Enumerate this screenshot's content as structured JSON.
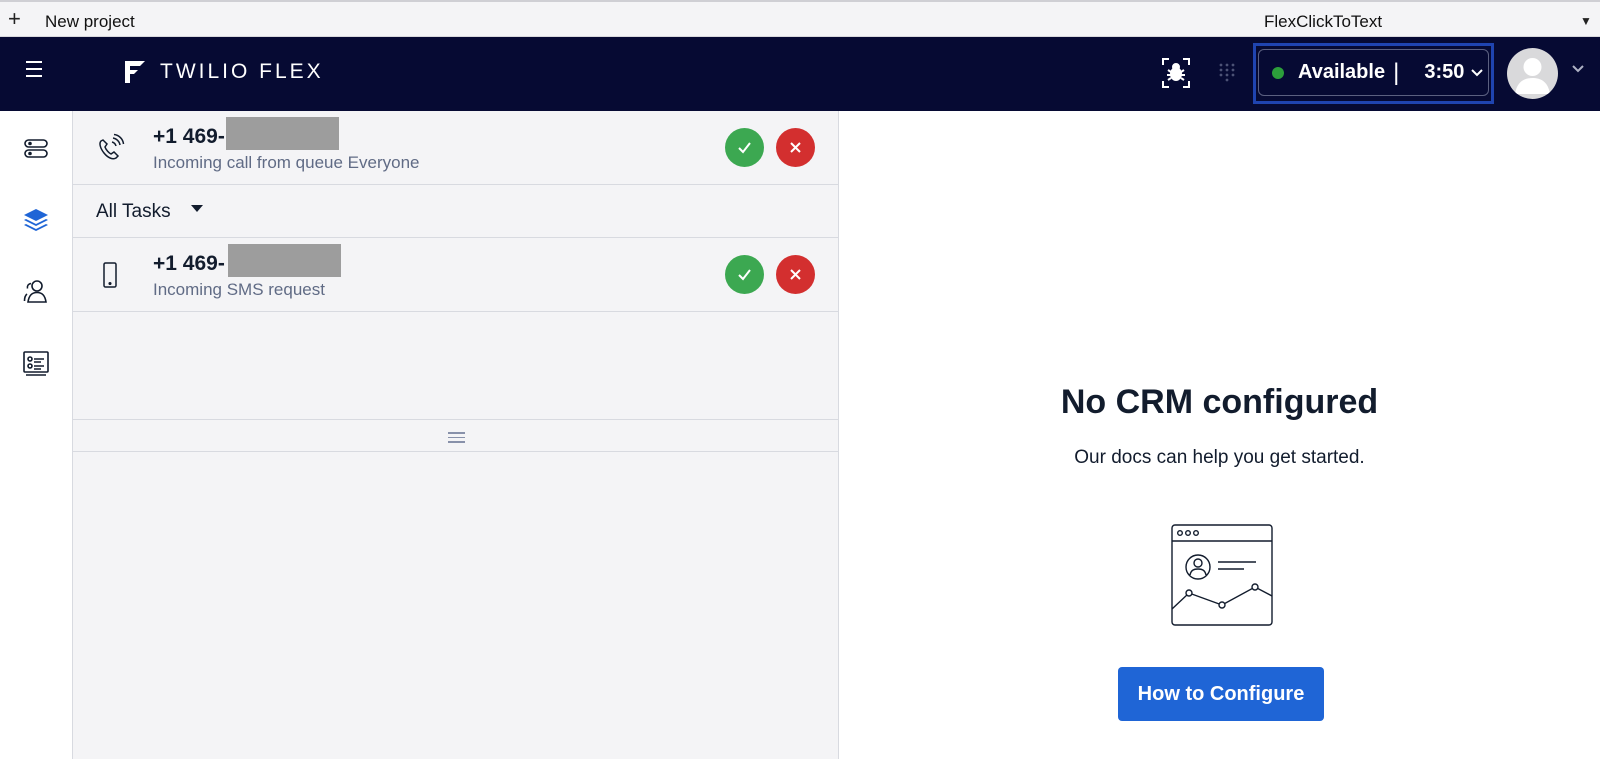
{
  "tabstrip": {
    "add_icon": "plus-icon",
    "project_label": "New project",
    "app_name": "FlexClickToText"
  },
  "header": {
    "brand": "TWILIO FLEX",
    "status": {
      "label": "Available",
      "divider": "|",
      "timer": "3:50",
      "indicator_color": "#2c9e3b"
    }
  },
  "rail": {
    "items": [
      {
        "icon": "agent-desktop-icon",
        "active": false
      },
      {
        "icon": "layers-icon",
        "active": true
      },
      {
        "icon": "teams-icon",
        "active": false
      },
      {
        "icon": "queues-stats-icon",
        "active": false
      }
    ]
  },
  "tasks": {
    "filter_label": "All Tasks",
    "items": [
      {
        "number": "+1 469-",
        "subtitle": "Incoming call from queue Everyone",
        "channel_icon": "phone-ringing-icon"
      },
      {
        "number": "+1 469-",
        "subtitle": "Incoming SMS request",
        "channel_icon": "mobile-phone-icon"
      }
    ]
  },
  "crm": {
    "title": "No CRM configured",
    "subtitle": "Our docs can help you get started.",
    "button_label": "How to Configure"
  },
  "colors": {
    "header_bg": "#060a33",
    "accept": "#3ca851",
    "reject": "#d32f2f",
    "primary": "#1f65d6",
    "status_outline": "#1f44b0"
  }
}
